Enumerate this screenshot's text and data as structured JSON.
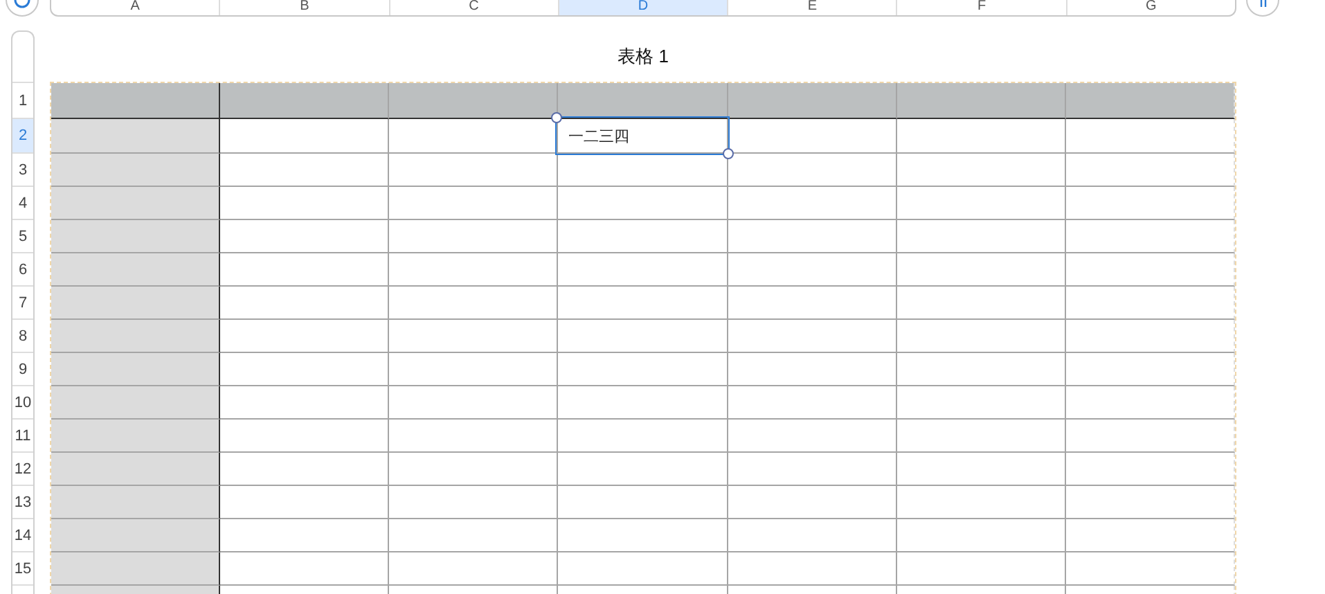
{
  "table": {
    "title": "表格 1",
    "columns": [
      {
        "label": "A",
        "kind": "header",
        "selected": false
      },
      {
        "label": "B",
        "kind": "body",
        "selected": false
      },
      {
        "label": "C",
        "kind": "body",
        "selected": false
      },
      {
        "label": "D",
        "kind": "body",
        "selected": true
      },
      {
        "label": "E",
        "kind": "body",
        "selected": false
      },
      {
        "label": "F",
        "kind": "body",
        "selected": false
      },
      {
        "label": "G",
        "kind": "body",
        "selected": false
      }
    ],
    "rows": [
      {
        "number": "1",
        "kind": "header",
        "selected": false
      },
      {
        "number": "2",
        "kind": "body",
        "selected": true,
        "cells": [
          {},
          {},
          {},
          {
            "value": "一二三四",
            "selected": true
          }
        ]
      },
      {
        "number": "3",
        "kind": "body",
        "selected": false
      },
      {
        "number": "4",
        "kind": "body",
        "selected": false
      },
      {
        "number": "5",
        "kind": "body",
        "selected": false
      },
      {
        "number": "6",
        "kind": "body",
        "selected": false
      },
      {
        "number": "7",
        "kind": "body",
        "selected": false
      },
      {
        "number": "8",
        "kind": "body",
        "selected": false
      },
      {
        "number": "9",
        "kind": "body",
        "selected": false
      },
      {
        "number": "10",
        "kind": "body",
        "selected": false
      },
      {
        "number": "11",
        "kind": "body",
        "selected": false
      },
      {
        "number": "12",
        "kind": "body",
        "selected": false
      },
      {
        "number": "13",
        "kind": "body",
        "selected": false
      },
      {
        "number": "14",
        "kind": "body",
        "selected": false
      },
      {
        "number": "15",
        "kind": "body",
        "selected": false
      }
    ]
  }
}
